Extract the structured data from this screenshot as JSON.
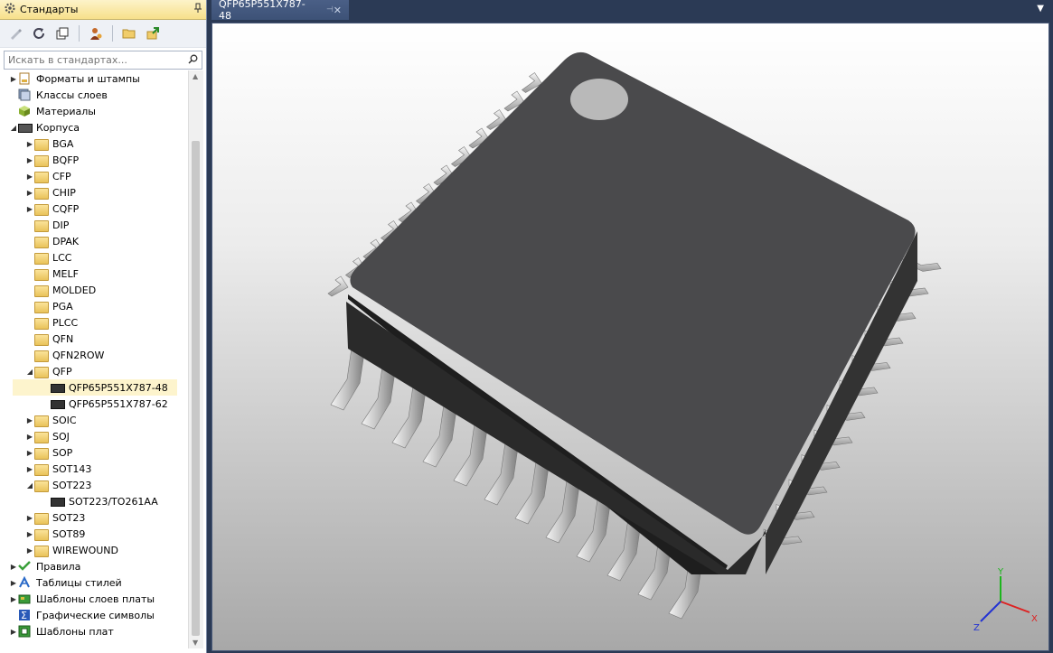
{
  "panel": {
    "title": "Стандарты",
    "search_placeholder": "Искать в стандартах..."
  },
  "tree": [
    {
      "label": "Форматы и штампы",
      "level": 0,
      "arrow": "collapsed",
      "icon": "formats-icon"
    },
    {
      "label": "Классы слоев",
      "level": 0,
      "arrow": "none",
      "icon": "layer-classes-icon"
    },
    {
      "label": "Материалы",
      "level": 0,
      "arrow": "none",
      "icon": "materials-cube-icon"
    },
    {
      "label": "Корпуса",
      "level": 0,
      "arrow": "expanded",
      "icon": "package-chip-icon"
    },
    {
      "label": "BGA",
      "level": 1,
      "arrow": "collapsed",
      "icon": "folder-icon"
    },
    {
      "label": "BQFP",
      "level": 1,
      "arrow": "collapsed",
      "icon": "folder-icon"
    },
    {
      "label": "CFP",
      "level": 1,
      "arrow": "collapsed",
      "icon": "folder-icon"
    },
    {
      "label": "CHIP",
      "level": 1,
      "arrow": "collapsed",
      "icon": "folder-icon"
    },
    {
      "label": "CQFP",
      "level": 1,
      "arrow": "collapsed",
      "icon": "folder-icon"
    },
    {
      "label": "DIP",
      "level": 1,
      "arrow": "none",
      "icon": "folder-icon"
    },
    {
      "label": "DPAK",
      "level": 1,
      "arrow": "none",
      "icon": "folder-icon"
    },
    {
      "label": "LCC",
      "level": 1,
      "arrow": "none",
      "icon": "folder-icon"
    },
    {
      "label": "MELF",
      "level": 1,
      "arrow": "none",
      "icon": "folder-icon"
    },
    {
      "label": "MOLDED",
      "level": 1,
      "arrow": "none",
      "icon": "folder-icon"
    },
    {
      "label": "PGA",
      "level": 1,
      "arrow": "none",
      "icon": "folder-icon"
    },
    {
      "label": "PLCC",
      "level": 1,
      "arrow": "none",
      "icon": "folder-icon"
    },
    {
      "label": "QFN",
      "level": 1,
      "arrow": "none",
      "icon": "folder-icon"
    },
    {
      "label": "QFN2ROW",
      "level": 1,
      "arrow": "none",
      "icon": "folder-icon"
    },
    {
      "label": "QFP",
      "level": 1,
      "arrow": "expanded",
      "icon": "folder-icon"
    },
    {
      "label": "QFP65P551X787-48",
      "level": 2,
      "arrow": "none",
      "icon": "chip-icon",
      "selected": true
    },
    {
      "label": "QFP65P551X787-62",
      "level": 2,
      "arrow": "none",
      "icon": "chip-icon"
    },
    {
      "label": "SOIC",
      "level": 1,
      "arrow": "collapsed",
      "icon": "folder-icon"
    },
    {
      "label": "SOJ",
      "level": 1,
      "arrow": "collapsed",
      "icon": "folder-icon"
    },
    {
      "label": "SOP",
      "level": 1,
      "arrow": "collapsed",
      "icon": "folder-icon"
    },
    {
      "label": "SOT143",
      "level": 1,
      "arrow": "collapsed",
      "icon": "folder-icon"
    },
    {
      "label": "SOT223",
      "level": 1,
      "arrow": "expanded",
      "icon": "folder-icon"
    },
    {
      "label": "SOT223/TO261AA",
      "level": 2,
      "arrow": "none",
      "icon": "chip-icon"
    },
    {
      "label": "SOT23",
      "level": 1,
      "arrow": "collapsed",
      "icon": "folder-icon"
    },
    {
      "label": "SOT89",
      "level": 1,
      "arrow": "collapsed",
      "icon": "folder-icon"
    },
    {
      "label": "WIREWOUND",
      "level": 1,
      "arrow": "collapsed",
      "icon": "folder-icon"
    },
    {
      "label": "Правила",
      "level": 0,
      "arrow": "collapsed",
      "icon": "rules-check-icon"
    },
    {
      "label": "Таблицы стилей",
      "level": 0,
      "arrow": "collapsed",
      "icon": "style-tables-icon"
    },
    {
      "label": "Шаблоны слоев платы",
      "level": 0,
      "arrow": "collapsed",
      "icon": "board-layers-icon"
    },
    {
      "label": "Графические символы",
      "level": 0,
      "arrow": "none",
      "icon": "sigma-icon"
    },
    {
      "label": "Шаблоны плат",
      "level": 0,
      "arrow": "collapsed",
      "icon": "board-template-icon"
    }
  ],
  "document": {
    "tab_title": "QFP65P551X787-48"
  },
  "axes": {
    "x": "X",
    "y": "Y",
    "z": "Z"
  },
  "colors": {
    "chip_body": "#4a4a4c",
    "pin": "#d8d8d8",
    "selection": "#fdf4cd",
    "titlebar": "#f7e08a",
    "background": "#2b3a55"
  }
}
